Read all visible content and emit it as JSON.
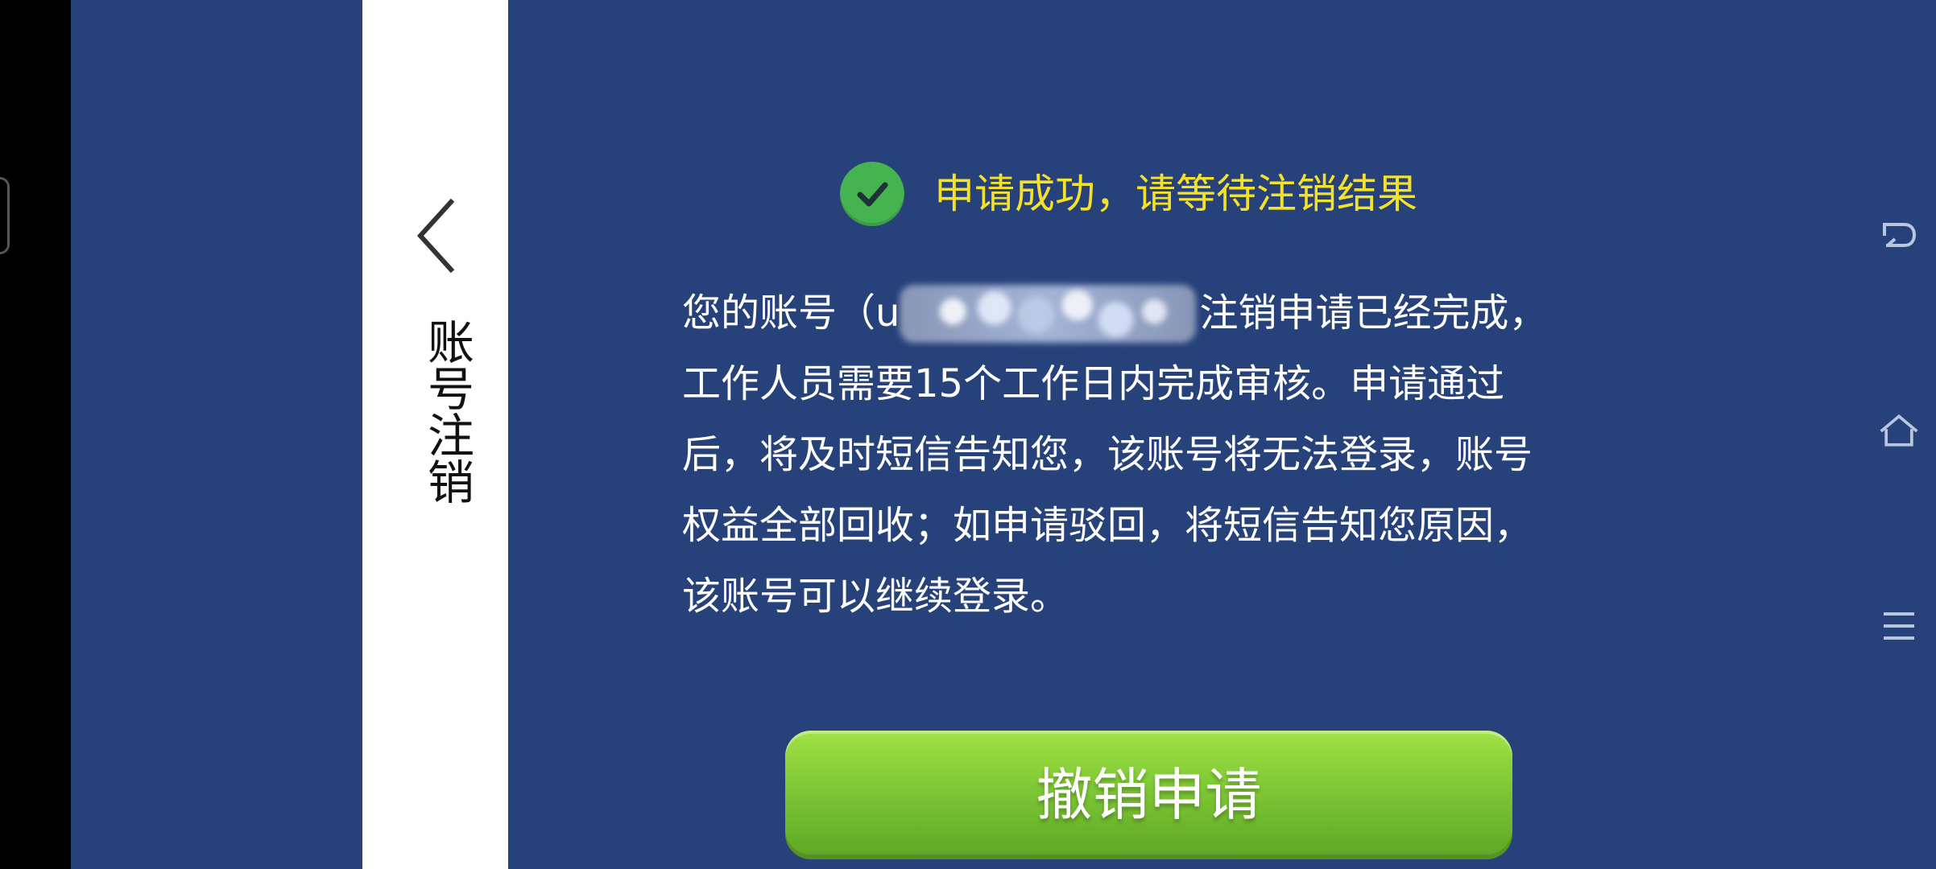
{
  "side_panel": {
    "title": "账号注销"
  },
  "icons": {
    "back": "chevron-left-icon",
    "success": "check-circle-icon",
    "system_back": "return-icon",
    "system_home": "home-icon",
    "system_menu": "menu-icon"
  },
  "status": {
    "title": "申请成功，请等待注销结果"
  },
  "message": {
    "line1_prefix": "您的账号（u",
    "line1_suffix": "注销申请已经完成，",
    "line2": "工作人员需要15个工作日内完成审核。申请通过",
    "line3": "后，将及时短信告知您，该账号将无法登录，账号",
    "line4": "权益全部回收；如申请驳回，将短信告知您原因，",
    "line5": "该账号可以继续登录。"
  },
  "actions": {
    "cancel_request": "撤销申请"
  },
  "colors": {
    "background": "#27417a",
    "success_green": "#45b34f",
    "success_text": "#f4e12a",
    "button_green": "#80c936"
  }
}
